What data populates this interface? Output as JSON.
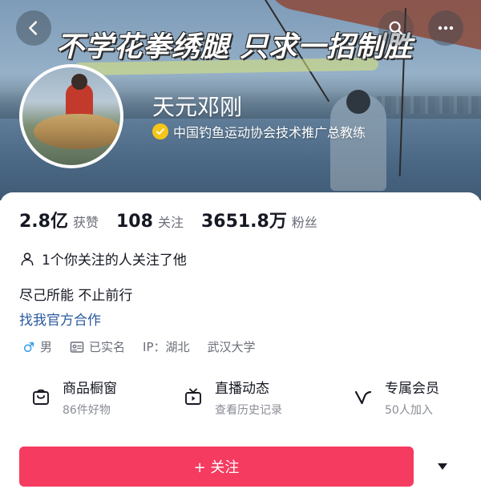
{
  "banner": {
    "slogan": "不学花拳绣腿  只求一招制胜"
  },
  "profile": {
    "name": "天元邓刚",
    "verification": "中国钓鱼运动协会技术推广总教练"
  },
  "stats": [
    {
      "value": "2.8亿",
      "label": "获赞"
    },
    {
      "value": "108",
      "label": "关注"
    },
    {
      "value": "3651.8万",
      "label": "粉丝"
    }
  ],
  "mutual": "1个你关注的人关注了他",
  "bio": {
    "line": "尽己所能 不止前行",
    "link": "找我官方合作"
  },
  "tags": {
    "gender": "男",
    "verified": "已实名",
    "ip": "IP：湖北",
    "school": "武汉大学"
  },
  "features": [
    {
      "title": "商品橱窗",
      "sub": "86件好物",
      "icon": "shop-bag-icon"
    },
    {
      "title": "直播动态",
      "sub": "查看历史记录",
      "icon": "live-tv-icon"
    },
    {
      "title": "专属会员",
      "sub": "50人加入",
      "icon": "membership-icon"
    }
  ],
  "follow": {
    "label": "+ 关注"
  },
  "colors": {
    "follow_button": "#f53b5f",
    "link": "#2a5a9e",
    "verify_badge": "#f5c518",
    "gender_icon": "#3aa0e8"
  }
}
